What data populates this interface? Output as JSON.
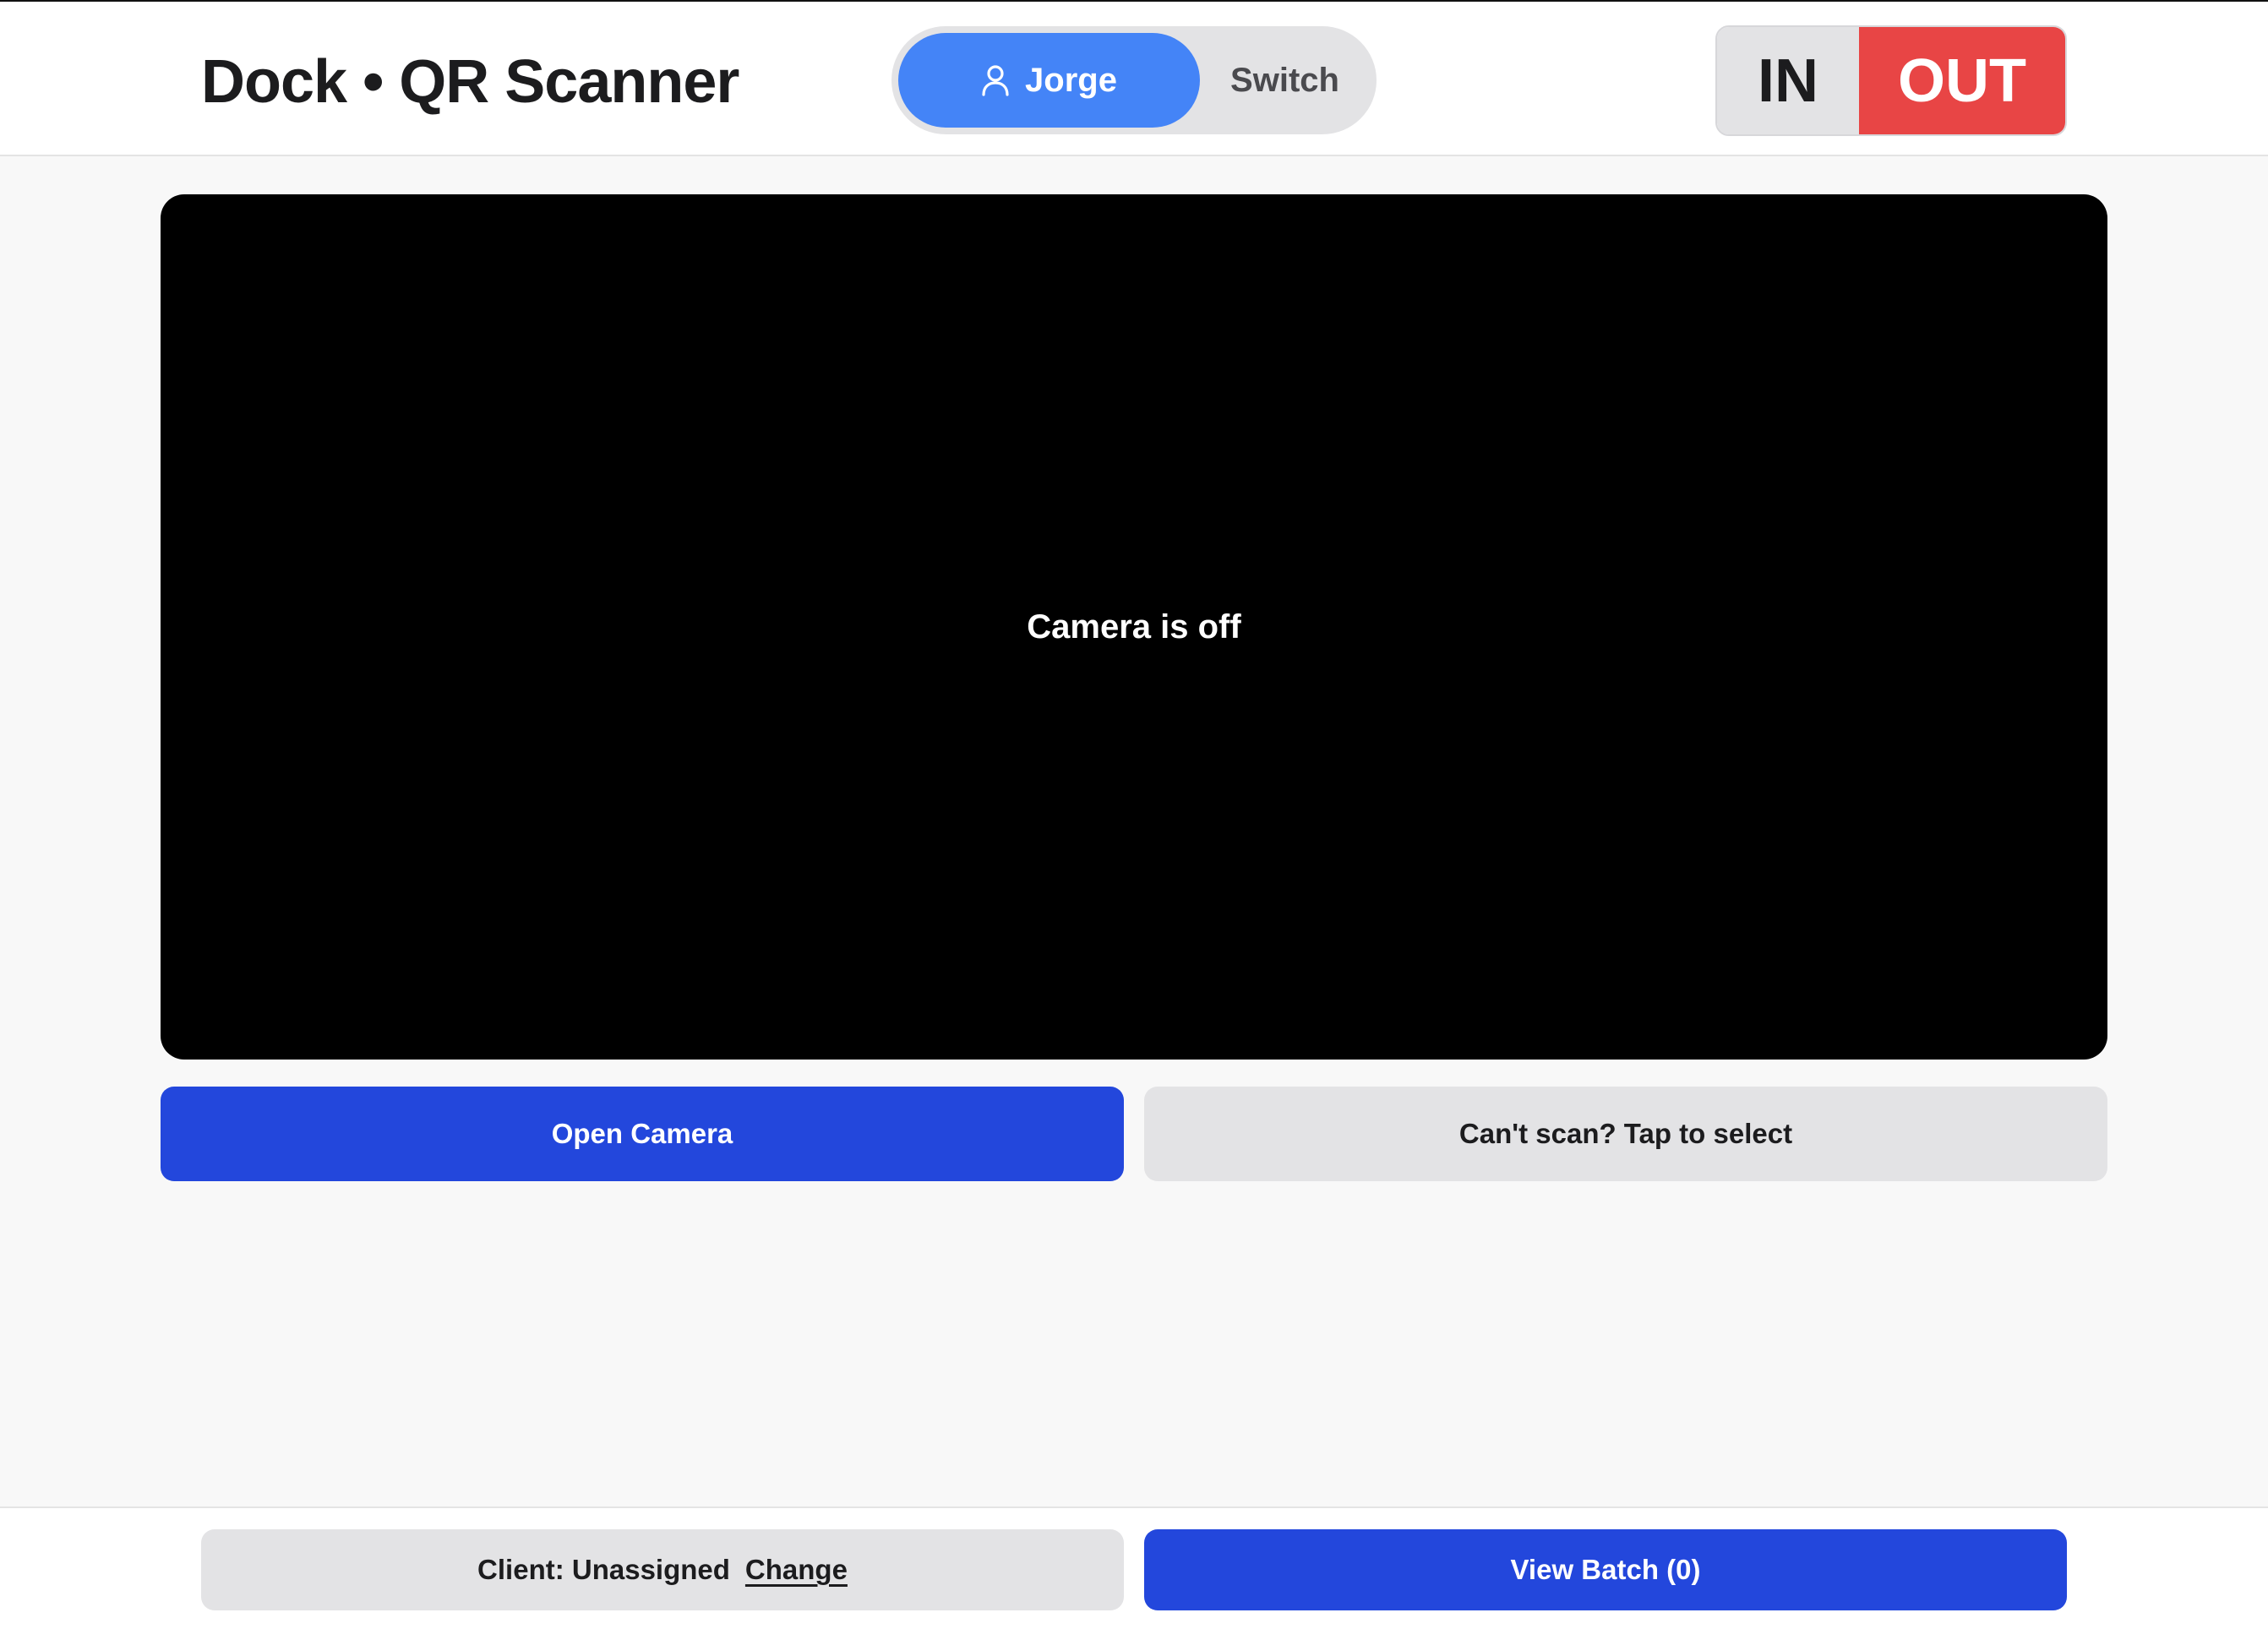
{
  "header": {
    "title": "Dock • QR Scanner",
    "user": {
      "name": "Jorge",
      "icon": "user-icon",
      "switch_label": "Switch"
    },
    "direction": {
      "in_label": "IN",
      "out_label": "OUT",
      "active": "OUT"
    }
  },
  "camera": {
    "status_text": "Camera is off"
  },
  "actions": {
    "open_camera_label": "Open Camera",
    "manual_select_label": "Can't scan? Tap to select"
  },
  "footer": {
    "client_label": "Client: Unassigned",
    "client_change_label": "Change",
    "view_batch_label": "View Batch (0)"
  },
  "colors": {
    "primary": "#2347dc",
    "user_pill": "#4484f7",
    "out_active": "#e84545",
    "neutral": "#e3e3e5"
  }
}
